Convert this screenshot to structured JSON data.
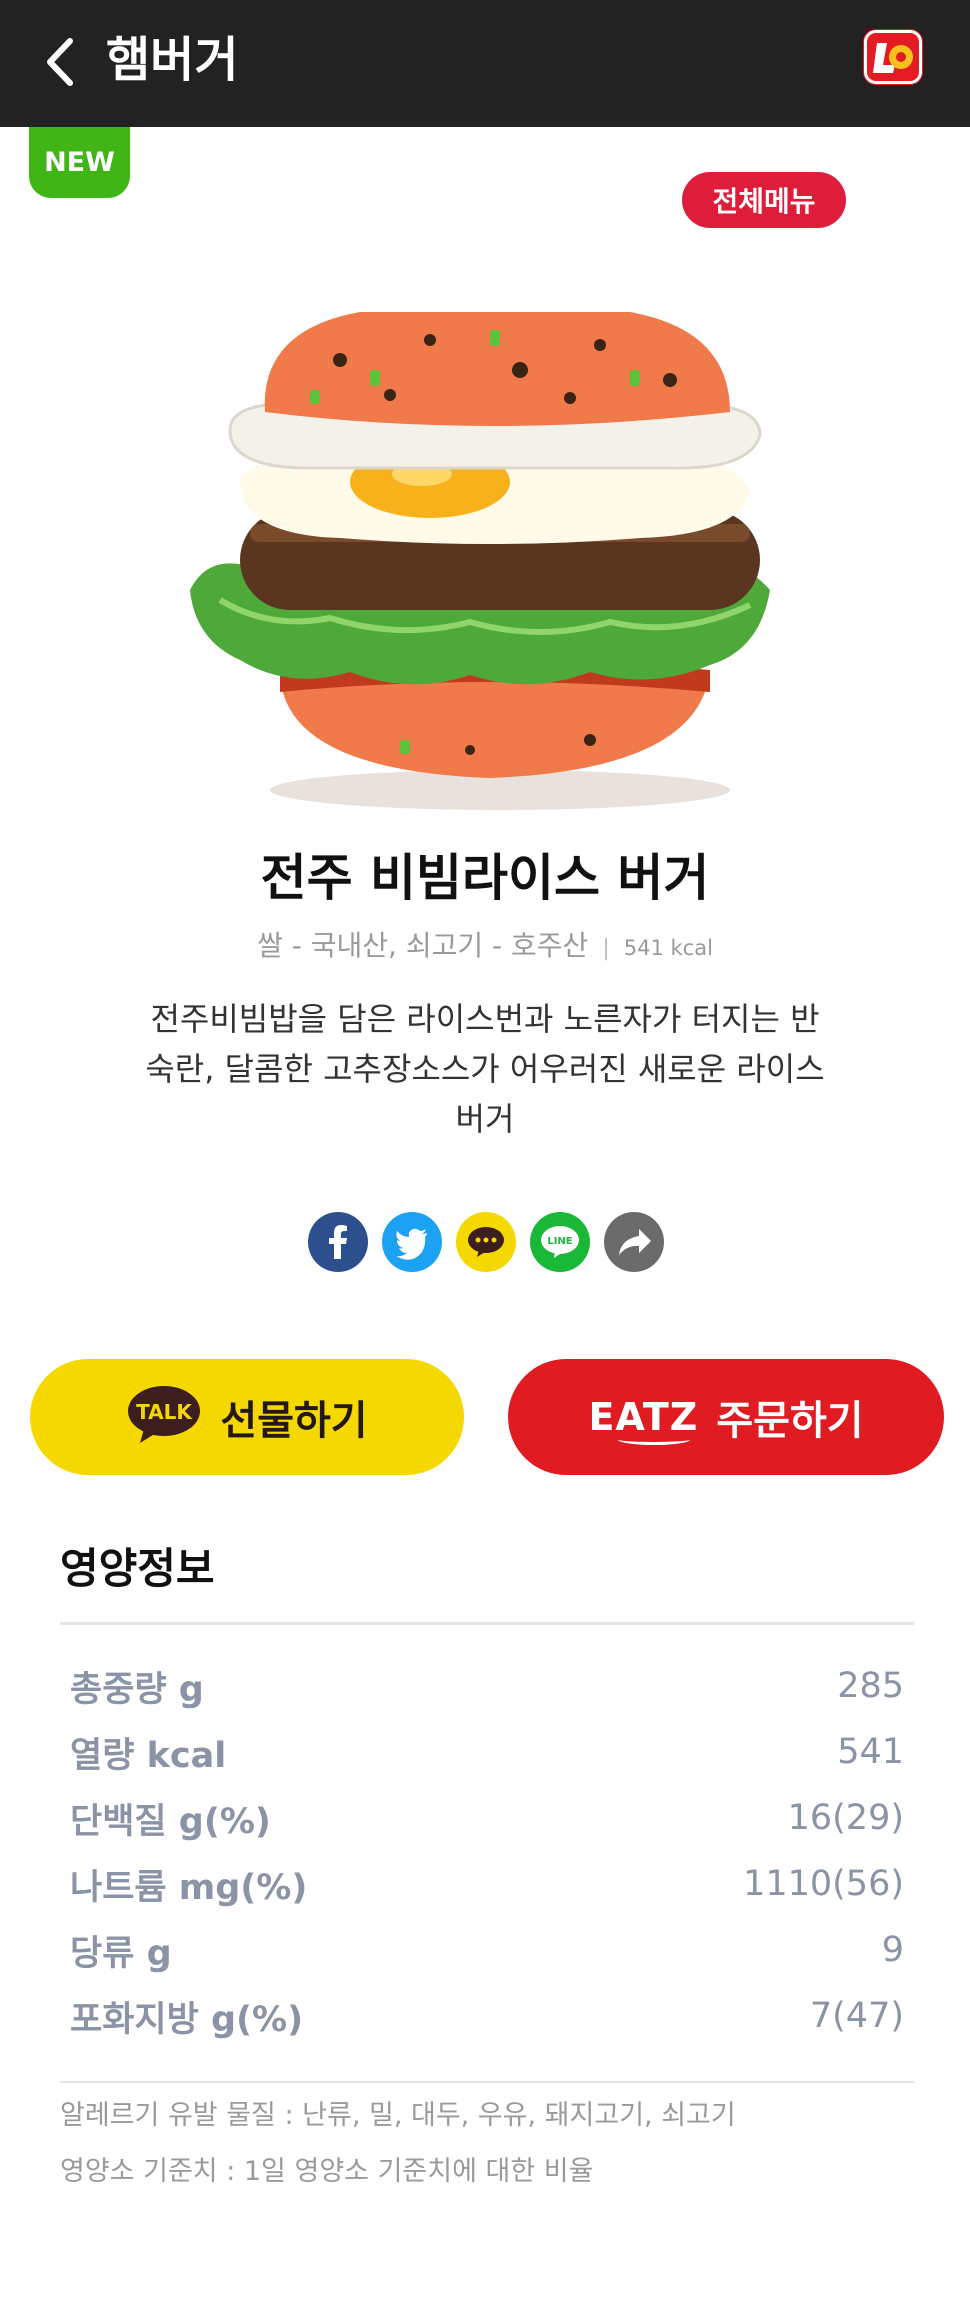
{
  "header": {
    "title": "햄버거",
    "logo_text": "L"
  },
  "badges": {
    "new": "NEW",
    "all_menu": "전체메뉴"
  },
  "product": {
    "name": "전주 비빔라이스 버거",
    "origin": "쌀 - 국내산, 쇠고기 - 호주산",
    "separator": "|",
    "kcal": "541 kcal",
    "description": "전주비빔밥을 담은 라이스번과 노른자가 터지는 반숙란, 달콤한 고추장소스가 어우러진 새로운 라이스버거"
  },
  "share": {
    "icons": [
      "facebook-icon",
      "twitter-icon",
      "kakaostory-icon",
      "line-icon",
      "share-icon"
    ],
    "colors": {
      "facebook": "#2d4f8e",
      "twitter": "#1da1f2",
      "kakao": "#f5d800",
      "line": "#19b837",
      "share": "#6b6b6b"
    }
  },
  "actions": {
    "gift_badge": "TALK",
    "gift_label": "선물하기",
    "order_brand": "EATZ",
    "order_label": "주문하기"
  },
  "nutrition": {
    "title": "영양정보",
    "rows": [
      {
        "label": "총중량 g",
        "value": "285"
      },
      {
        "label": "열량 kcal",
        "value": "541"
      },
      {
        "label": "단백질 g(%)",
        "value": "16(29)"
      },
      {
        "label": "나트륨 mg(%)",
        "value": "1110(56)"
      },
      {
        "label": "당류 g",
        "value": "9"
      },
      {
        "label": "포화지방 g(%)",
        "value": "7(47)"
      }
    ],
    "allergy_note": "알레르기 유발 물질 : 난류, 밀, 대두, 우유, 돼지고기, 쇠고기",
    "standard_note": "영양소 기준치 : 1일 영양소 기준치에 대한 비율"
  },
  "colors": {
    "header_bg": "#222222",
    "new_badge": "#3fb516",
    "all_menu": "#de1d3a",
    "gift_button": "#f5d800",
    "order_button": "#e11b22"
  }
}
